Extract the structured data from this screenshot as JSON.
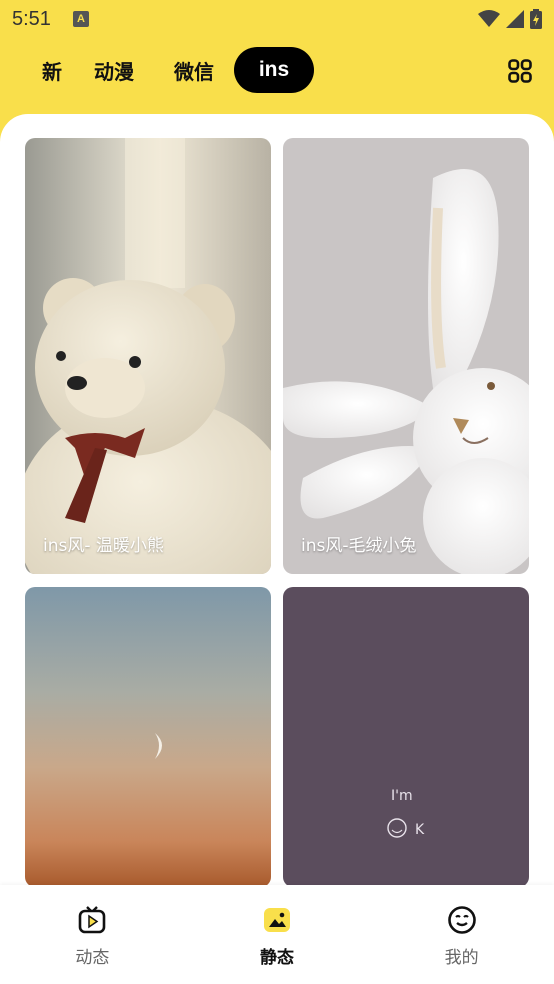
{
  "status_bar": {
    "time": "5:51",
    "notification_glyph": "A",
    "icons": [
      "wifi-icon",
      "signal-icon",
      "battery-icon"
    ]
  },
  "tabs": {
    "items": [
      {
        "label": "新",
        "cut_label": "最新"
      },
      {
        "label": "动漫"
      },
      {
        "label": "微信"
      },
      {
        "label": "ins"
      }
    ],
    "active_index": 3,
    "grid_icon": "grid-icon"
  },
  "cards": [
    {
      "title": "ins风- 温暖小熊"
    },
    {
      "title": "ins风-毛绒小兔"
    },
    {
      "title": ""
    },
    {
      "title": "",
      "handwriting": "I'm ☺ K"
    }
  ],
  "bottom_nav": {
    "items": [
      {
        "label": "动态",
        "icon": "video-play-icon"
      },
      {
        "label": "静态",
        "icon": "image-icon"
      },
      {
        "label": "我的",
        "icon": "smile-icon"
      }
    ],
    "active_index": 1
  },
  "colors": {
    "accent": "#f9df4b",
    "active_tab_bg": "#000000"
  }
}
